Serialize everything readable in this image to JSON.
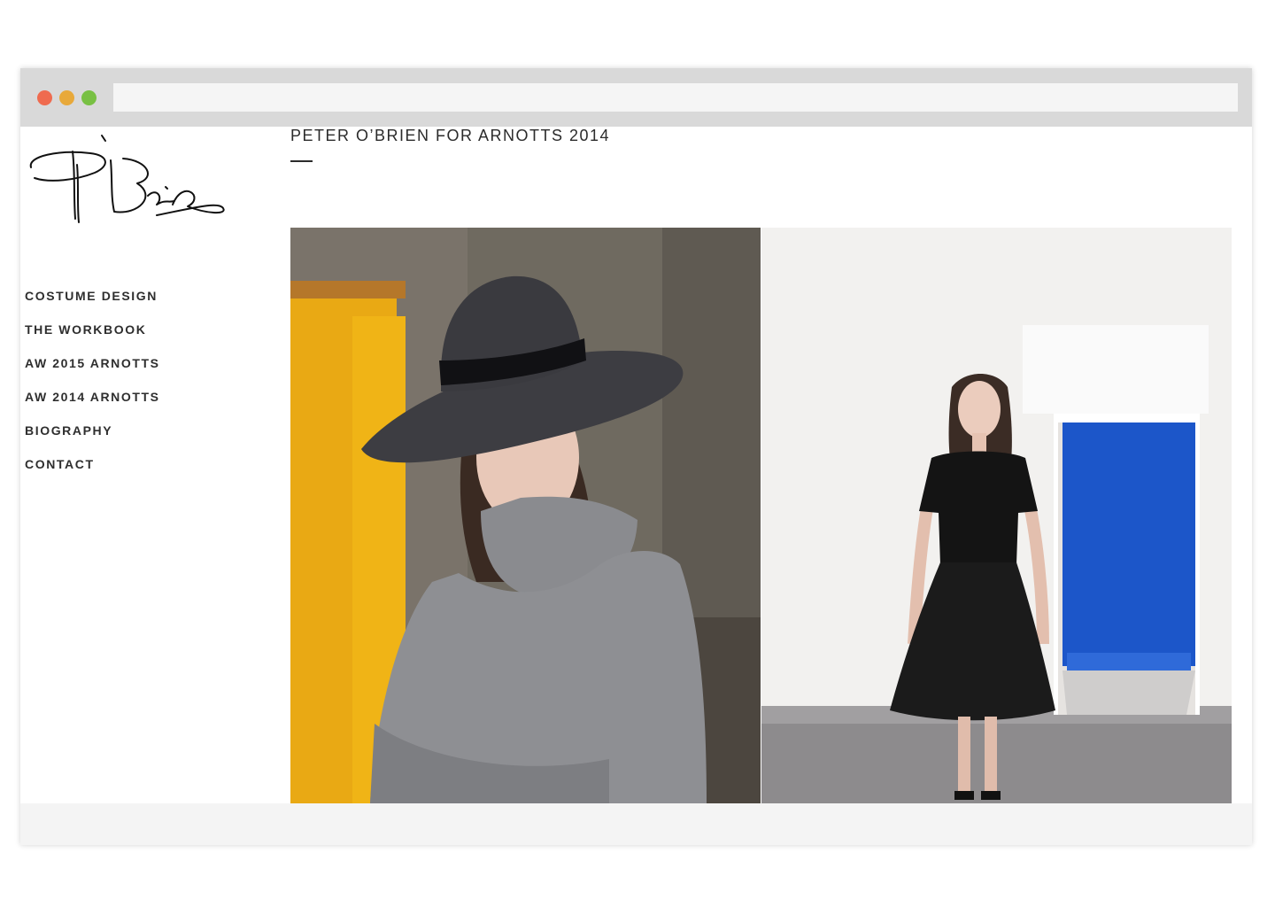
{
  "site": {
    "title": "PETER O’BRIEN FOR ARNOTTS 2014",
    "logo_text": "P O'Brien"
  },
  "browser": {
    "address": ""
  },
  "nav": {
    "items": [
      {
        "label": "COSTUME DESIGN"
      },
      {
        "label": "THE WORKBOOK"
      },
      {
        "label": "AW 2015 ARNOTTS"
      },
      {
        "label": "AW 2014 ARNOTTS"
      },
      {
        "label": "BIOGRAPHY"
      },
      {
        "label": "CONTACT"
      }
    ]
  },
  "colors": {
    "traffic_red": "#ef6b4f",
    "traffic_yellow": "#e8a93a",
    "traffic_green": "#78c043",
    "text": "#2b2b2b"
  }
}
